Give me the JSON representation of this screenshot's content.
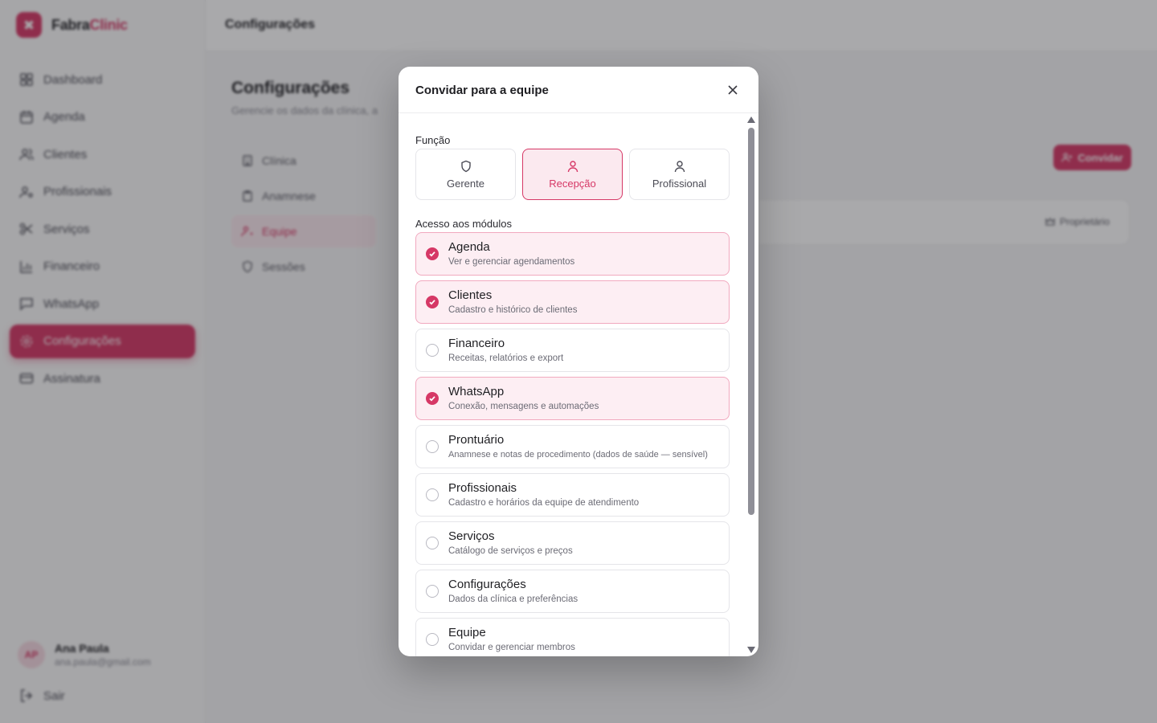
{
  "brand": {
    "name_a": "Fabra",
    "name_b": "Clinic",
    "color": "#d63866"
  },
  "sidebar": {
    "items": [
      {
        "label": "Dashboard",
        "icon": "dashboard-icon"
      },
      {
        "label": "Agenda",
        "icon": "calendar-icon"
      },
      {
        "label": "Clientes",
        "icon": "users-icon"
      },
      {
        "label": "Profissionais",
        "icon": "user-cog-icon"
      },
      {
        "label": "Serviços",
        "icon": "scissors-icon"
      },
      {
        "label": "Financeiro",
        "icon": "bar-chart-icon"
      },
      {
        "label": "WhatsApp",
        "icon": "message-icon"
      },
      {
        "label": "Configurações",
        "icon": "gear-icon",
        "active": true
      },
      {
        "label": "Assinatura",
        "icon": "credit-card-icon"
      }
    ],
    "user": {
      "initials": "AP",
      "name": "Ana Paula",
      "email": "ana.paula@gmail.com"
    },
    "logout_label": "Sair"
  },
  "topbar": {
    "title": "Configurações"
  },
  "page": {
    "title": "Configurações",
    "subtitle": "Gerencie os dados da clínica, a",
    "subnav": [
      {
        "label": "Clínica",
        "icon": "building-icon"
      },
      {
        "label": "Anamnese",
        "icon": "clipboard-icon"
      },
      {
        "label": "Equipe",
        "icon": "user-cog-icon",
        "active": true
      },
      {
        "label": "Sessões",
        "icon": "shield-icon"
      }
    ],
    "invite_button": "Convidar",
    "owner_badge": "Proprietário"
  },
  "modal": {
    "title": "Convidar para a equipe",
    "role_label": "Função",
    "roles": [
      {
        "label": "Gerente",
        "icon": "shield-icon",
        "selected": false
      },
      {
        "label": "Recepção",
        "icon": "user-icon",
        "selected": true
      },
      {
        "label": "Profissional",
        "icon": "user-icon",
        "selected": false
      }
    ],
    "modules_label": "Acesso aos módulos",
    "modules": [
      {
        "title": "Agenda",
        "desc": "Ver e gerenciar agendamentos",
        "checked": true
      },
      {
        "title": "Clientes",
        "desc": "Cadastro e histórico de clientes",
        "checked": true
      },
      {
        "title": "Financeiro",
        "desc": "Receitas, relatórios e export",
        "checked": false
      },
      {
        "title": "WhatsApp",
        "desc": "Conexão, mensagens e automações",
        "checked": true
      },
      {
        "title": "Prontuário",
        "desc": "Anamnese e notas de procedimento (dados de saúde — sensível)",
        "checked": false
      },
      {
        "title": "Profissionais",
        "desc": "Cadastro e horários da equipe de atendimento",
        "checked": false
      },
      {
        "title": "Serviços",
        "desc": "Catálogo de serviços e preços",
        "checked": false
      },
      {
        "title": "Configurações",
        "desc": "Dados da clínica e preferências",
        "checked": false
      },
      {
        "title": "Equipe",
        "desc": "Convidar e gerenciar membros",
        "checked": false
      }
    ]
  }
}
